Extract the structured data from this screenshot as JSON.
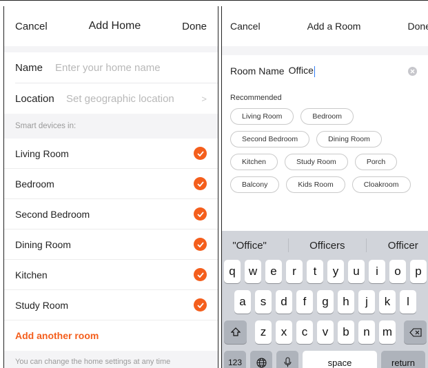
{
  "left": {
    "nav": {
      "cancel": "Cancel",
      "title": "Add Home",
      "done": "Done"
    },
    "name_label": "Name",
    "name_placeholder": "Enter your home name",
    "location_label": "Location",
    "location_placeholder": "Set geographic location",
    "section_label": "Smart devices in:",
    "rooms": [
      "Living Room",
      "Bedroom",
      "Second Bedroom",
      "Dining Room",
      "Kitchen",
      "Study Room"
    ],
    "add_room": "Add another room",
    "footer": "You can change the home settings at any time",
    "accent": "#f45e1c"
  },
  "right": {
    "nav": {
      "cancel": "Cancel",
      "title": "Add a Room",
      "done": "Done"
    },
    "room_name_label": "Room Name",
    "room_name_value": "Office",
    "recommended_label": "Recommended",
    "chips": [
      "Living Room",
      "Bedroom",
      "Second Bedroom",
      "Dining Room",
      "Kitchen",
      "Study Room",
      "Porch",
      "Balcony",
      "Kids Room",
      "Cloakroom"
    ],
    "keyboard": {
      "suggestions": [
        "\"Office\"",
        "Officers",
        "Officer"
      ],
      "row1": [
        "q",
        "w",
        "e",
        "r",
        "t",
        "y",
        "u",
        "i",
        "o",
        "p"
      ],
      "row2": [
        "a",
        "s",
        "d",
        "f",
        "g",
        "h",
        "j",
        "k",
        "l"
      ],
      "row3": [
        "z",
        "x",
        "c",
        "v",
        "b",
        "n",
        "m"
      ],
      "num_key": "123",
      "space": "space",
      "return": "return"
    }
  }
}
